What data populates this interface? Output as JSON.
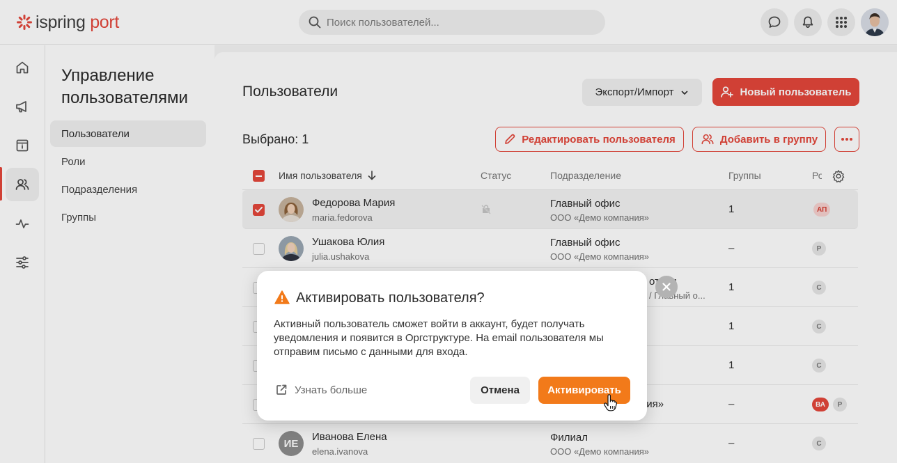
{
  "brand": {
    "name_part1": "ispring",
    "name_part2": " port",
    "accent": "#e4473b"
  },
  "header": {
    "search_placeholder": "Поиск пользователей...",
    "icons": [
      "chat-icon",
      "bell-icon",
      "apps-grid-icon",
      "user-avatar"
    ]
  },
  "rail": {
    "items": [
      "home-icon",
      "megaphone-icon",
      "catalog-icon",
      "users-icon",
      "activity-icon",
      "settings-sliders-icon"
    ],
    "active": "users-icon"
  },
  "section": {
    "title": "Управление пользователями",
    "items": [
      {
        "label": "Пользователи",
        "active": true
      },
      {
        "label": "Роли",
        "active": false
      },
      {
        "label": "Подразделения",
        "active": false
      },
      {
        "label": "Группы",
        "active": false
      }
    ]
  },
  "main": {
    "title": "Пользователи",
    "export_label": "Экспорт/Импорт",
    "new_user_label": "Новый пользователь",
    "selected_label": "Выбрано: 1",
    "edit_user_label": "Редактировать пользователя",
    "add_to_group_label": "Добавить в группу"
  },
  "table": {
    "columns": {
      "name": "Имя пользователя",
      "status": "Статус",
      "department": "Подразделение",
      "groups": "Группы",
      "roles": "Ро"
    },
    "rows": [
      {
        "name": "Федорова Мария",
        "login": "maria.fedorova",
        "dept": "Главный офис",
        "dept_sub": "ООО «Демо компания»",
        "groups": "1",
        "badges": [
          {
            "text": "АП",
            "style": "red"
          }
        ],
        "checked": true
      },
      {
        "name": "Ушакова Юлия",
        "login": "julia.ushakova",
        "dept": "Главный офис",
        "dept_sub": "ООО «Демо компания»",
        "groups": "–",
        "badges": [
          {
            "text": "Р",
            "style": "gray"
          }
        ],
        "checked": false
      },
      {
        "name": "",
        "login": "",
        "dept": "отдел",
        "dept_sub": "/ Главный о...",
        "groups": "1",
        "badges": [
          {
            "text": "С",
            "style": "gray"
          }
        ],
        "checked": false
      },
      {
        "name": "",
        "login": "",
        "dept": "",
        "dept_sub": "",
        "groups": "1",
        "badges": [
          {
            "text": "С",
            "style": "gray"
          }
        ],
        "checked": false
      },
      {
        "name": "",
        "login": "",
        "dept": "",
        "dept_sub": "",
        "groups": "1",
        "badges": [
          {
            "text": "С",
            "style": "gray"
          }
        ],
        "checked": false
      },
      {
        "name": "",
        "login": "",
        "dept": "ния»",
        "dept_sub": "",
        "groups": "–",
        "badges": [
          {
            "text": "ВА",
            "style": "redsolid"
          },
          {
            "text": "Р",
            "style": "gray"
          }
        ],
        "checked": false
      },
      {
        "name": "Иванова Елена",
        "initials": "ИЕ",
        "login": "elena.ivanova",
        "dept": "Филиал",
        "dept_sub": "ООО «Демо компания»",
        "groups": "–",
        "badges": [
          {
            "text": "С",
            "style": "gray"
          }
        ],
        "checked": false
      }
    ]
  },
  "modal": {
    "title": "Активировать пользователя?",
    "body": "Активный пользователь сможет войти в аккаунт, будет получать уведомления и появится в Оргструктуре. На email пользователя мы отправим письмо с данными для входа.",
    "learn_more": "Узнать больше",
    "cancel": "Отмена",
    "confirm": "Активировать",
    "confirm_color": "#f27a1a"
  }
}
